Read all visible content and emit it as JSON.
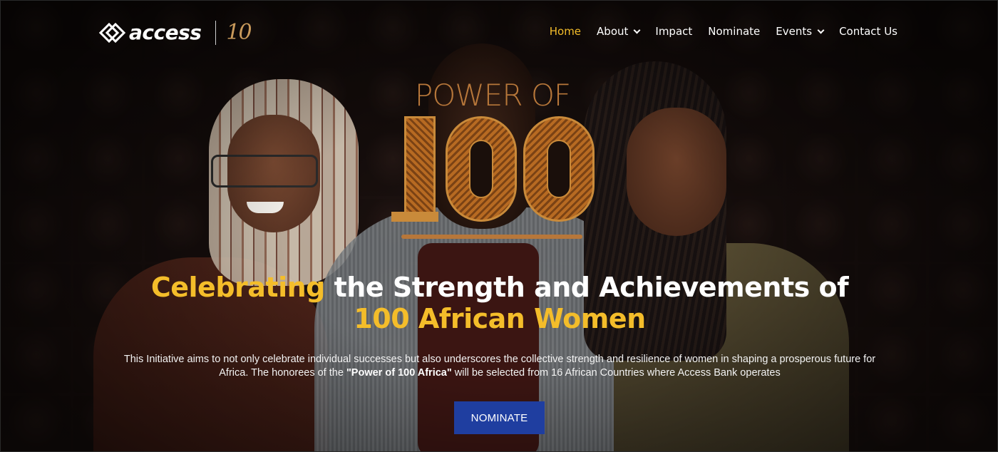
{
  "brand": {
    "wordmark": "access",
    "anniversary_mark": "10"
  },
  "nav": {
    "items": [
      {
        "label": "Home",
        "active": true,
        "has_dropdown": false
      },
      {
        "label": "About",
        "active": false,
        "has_dropdown": true
      },
      {
        "label": "Impact",
        "active": false,
        "has_dropdown": false
      },
      {
        "label": "Nominate",
        "active": false,
        "has_dropdown": false
      },
      {
        "label": "Events",
        "active": false,
        "has_dropdown": true
      },
      {
        "label": "Contact Us",
        "active": false,
        "has_dropdown": false
      }
    ]
  },
  "hero": {
    "emblem_title": "POWER OF",
    "emblem_number": "100",
    "headline_accent": "Celebrating",
    "headline_rest": " the Strength and Achievements of",
    "headline_line2": "100 African Women",
    "description_part1": "This Initiative aims to not only celebrate individual successes but also underscores the collective strength and resilience of women in shaping a prosperous future for Africa. The honorees of the ",
    "description_bold": "\"Power of 100 Africa\"",
    "description_part2": " will be selected from 16 African Countries where Access Bank operates",
    "cta_label": "NOMINATE"
  },
  "colors": {
    "accent": "#f4bd2a",
    "cta": "#1f3ea0",
    "emblem": "#b7773a"
  }
}
